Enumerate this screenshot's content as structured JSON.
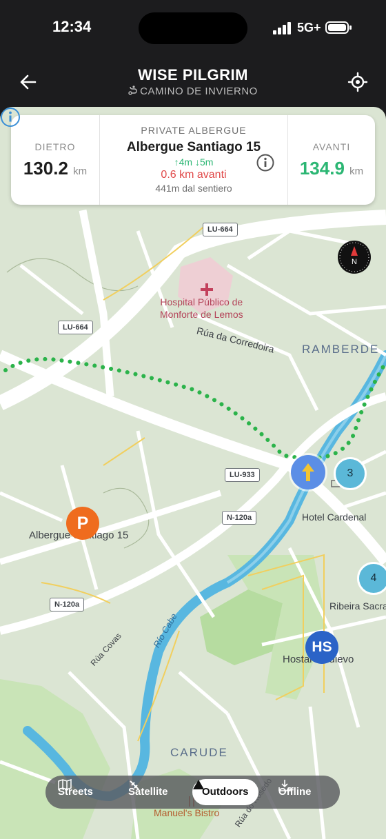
{
  "status": {
    "time": "12:34",
    "network": "5G+"
  },
  "header": {
    "title": "WISE PILGRIM",
    "subtitle": "CAMINO DE INVIERNO"
  },
  "card": {
    "left_label": "DIETRO",
    "left_value": "130.2",
    "left_unit": "km",
    "category": "PRIVATE ALBERGUE",
    "name": "Albergue Santiago 15",
    "elev_up": "↑4m",
    "elev_down": "↓5m",
    "distance_ahead": "0.6 km avanti",
    "off_trail": "441m dal sentiero",
    "right_label": "AVANTI",
    "right_value": "134.9",
    "right_unit": "km"
  },
  "map": {
    "roads": {
      "lu664_top": "LU-664",
      "lu664_left": "LU-664",
      "lu933": "LU-933",
      "n120a_1": "N-120a",
      "n120a_2": "N-120a"
    },
    "labels": {
      "hospital_1": "Hospital Público de",
      "hospital_2": "Monforte de Lemos",
      "corredoira": "Rúa da Corredoira",
      "ramberde": "RAMBERDE",
      "hotel": "Hotel Cardenal",
      "albergue": "Albergue Santiago 15",
      "ribeira": "Ribeira Sacra",
      "covas": "Rúa Covas",
      "cabe": "Río Cabe",
      "hostal": "Hostal Medievo",
      "carude": "CARUDE",
      "bistro": "Manuel's Bistro",
      "rosedo": "Rúa do Rosedo"
    },
    "markers": {
      "cluster_a": "3",
      "cluster_b": "4",
      "parking": "P",
      "hostal_badge": "HS",
      "compass": "N"
    },
    "colors": {
      "trail": "#2bb34a",
      "river": "#58b7e0",
      "position": "#5b8ee6"
    }
  },
  "layers": {
    "streets": "Streets",
    "satellite": "Satellite",
    "outdoors": "Outdoors",
    "offline": "Offline",
    "selected": "Outdoors"
  }
}
